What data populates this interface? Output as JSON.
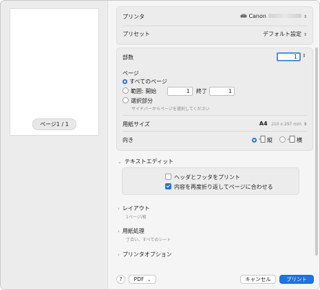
{
  "preview": {
    "page_counter": "ページ1 / 1"
  },
  "printer": {
    "label": "プリンタ",
    "value": "Canon"
  },
  "preset": {
    "label": "プリセット",
    "value": "デフォルト設定"
  },
  "copies": {
    "label": "部数",
    "value": "1"
  },
  "pages": {
    "label": "ページ",
    "all_label": "すべてのページ",
    "range_label": "範囲: 開始",
    "range_from": "1",
    "range_to_label": "終了",
    "range_to": "1",
    "selection_label": "選択部分",
    "selection_hint": "サイドバーからページを選択してください"
  },
  "paper_size": {
    "label": "用紙サイズ",
    "value": "A4",
    "dims": "210 x 297 mm"
  },
  "orientation": {
    "label": "向き",
    "portrait_label": "縦",
    "landscape_label": "横",
    "selected": "portrait"
  },
  "textedit": {
    "title": "テキストエディット",
    "option_headers": "ヘッダとフッタをプリント",
    "option_headers_checked": false,
    "option_rewrap": "内容を再度折り返してページに合わせる",
    "option_rewrap_checked": true
  },
  "layout": {
    "title": "レイアウト",
    "subtitle": "1ページ/枚"
  },
  "paper_handling": {
    "title": "用紙処理",
    "subtitle": "丁合い、すべてのシート"
  },
  "printer_options": {
    "title": "プリンタオプション"
  },
  "footer": {
    "help": "?",
    "pdf": "PDF",
    "cancel": "キャンセル",
    "print": "プリント"
  },
  "colors": {
    "accent": "#1a73e8",
    "pane_bg": "#f5f5f5",
    "group_bg": "#ececec"
  }
}
